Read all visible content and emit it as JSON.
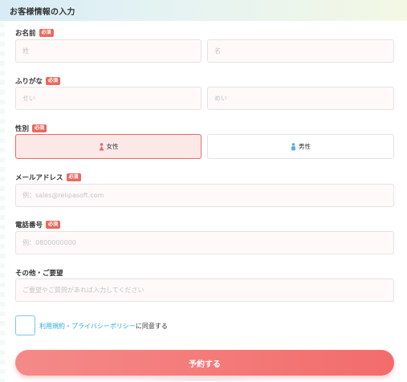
{
  "header": {
    "title": "お客様情報の入力"
  },
  "required_badge": "必須",
  "name": {
    "label": "お名前",
    "last_placeholder": "姓",
    "first_placeholder": "名"
  },
  "kana": {
    "label": "ふりがな",
    "last_placeholder": "せい",
    "first_placeholder": "めい"
  },
  "gender": {
    "label": "性別",
    "options": [
      {
        "label": "女性",
        "icon": "female-icon",
        "selected": true
      },
      {
        "label": "男性",
        "icon": "male-icon",
        "selected": false
      }
    ]
  },
  "email": {
    "label": "メールアドレス",
    "placeholder": "例：sales@relipasoft.com"
  },
  "phone": {
    "label": "電話番号",
    "placeholder": "例：0800000000"
  },
  "other": {
    "label": "その他・ご要望",
    "placeholder": "ご要望やご質問があれば入力してください"
  },
  "agreement": {
    "link_text": "利用規約・プライバシーポリシー",
    "suffix_text": "に同意する",
    "checked": false
  },
  "submit": {
    "label": "予約する"
  },
  "colors": {
    "accent": "#f36c6c",
    "link": "#2aa9dc",
    "badge": "#e8695f",
    "female_icon": "#e06a6a",
    "male_icon": "#4fb3e0"
  }
}
